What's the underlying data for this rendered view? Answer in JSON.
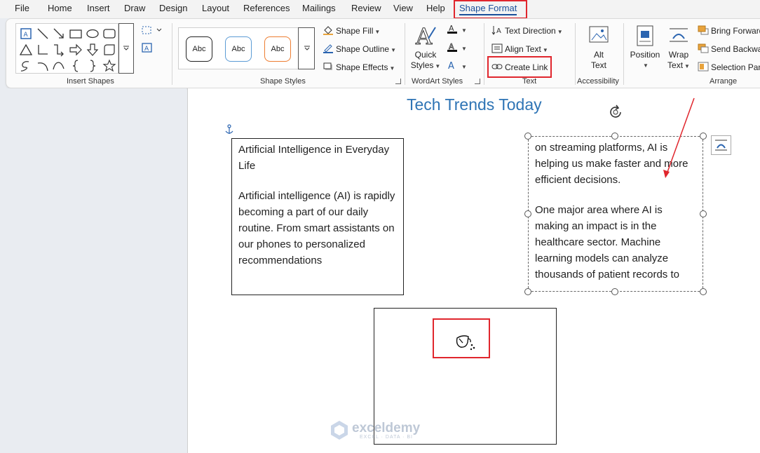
{
  "tabs": [
    "File",
    "Home",
    "Insert",
    "Draw",
    "Design",
    "Layout",
    "References",
    "Mailings",
    "Review",
    "View",
    "Help",
    "Shape Format"
  ],
  "active_tab": "Shape Format",
  "ribbon": {
    "groups": {
      "insert_shapes": "Insert Shapes",
      "shape_styles": "Shape Styles",
      "wordart_styles": "WordArt Styles",
      "text": "Text",
      "accessibility": "Accessibility",
      "arrange": "Arrange"
    },
    "style_presets": [
      "Abc",
      "Abc",
      "Abc"
    ],
    "style_colors": [
      "#222222",
      "#5b9bd5",
      "#ed7d31"
    ],
    "shape_fill": "Shape Fill",
    "shape_outline": "Shape Outline",
    "shape_effects": "Shape Effects",
    "quick_styles": [
      "Quick",
      "Styles"
    ],
    "text_direction": "Text Direction",
    "align_text": "Align Text",
    "create_link": "Create Link",
    "alt_text": [
      "Alt",
      "Text"
    ],
    "position": "Position",
    "wrap_text": [
      "Wrap",
      "Text"
    ],
    "bring_forward": "Bring Forward",
    "send_backward": "Send Backward",
    "selection_pane": "Selection Pane"
  },
  "document": {
    "title": "Tech Trends Today",
    "textbox1": {
      "heading": "Artificial Intelligence in Everyday Life",
      "body": "Artificial intelligence (AI) is rapidly becoming a part of our daily routine. From smart assistants on our phones to personalized recommendations"
    },
    "textbox2": {
      "para1": "on streaming platforms, AI is helping us make faster and more efficient decisions.",
      "para2": "One major area where AI is making an impact is in the healthcare sector. Machine learning models can analyze thousands of patient records to"
    }
  },
  "watermark": {
    "name": "exceldemy",
    "tagline": "EXCEL · DATA · BI"
  },
  "colors": {
    "accent": "#1a4f9a",
    "title": "#2e74b5",
    "highlight": "#e0262d"
  }
}
